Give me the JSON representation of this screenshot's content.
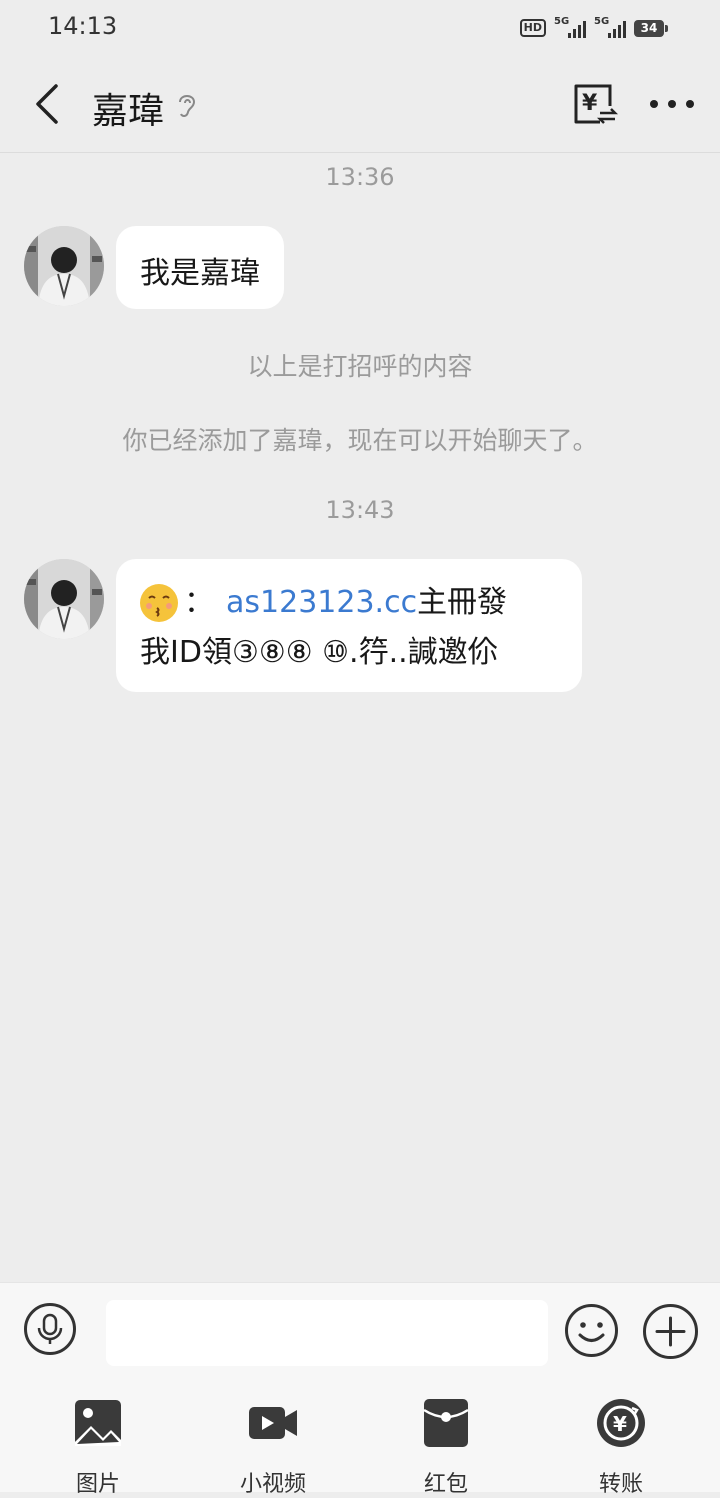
{
  "status_bar": {
    "time": "14:13",
    "hd_label": "HD",
    "network1": "5G",
    "network2": "5G",
    "battery": "34"
  },
  "header": {
    "title": "嘉瑋",
    "icons": [
      "back-arrow-icon",
      "ear-icon",
      "transfer-icon",
      "more-icon"
    ]
  },
  "chat": {
    "timestamp1": "13:36",
    "message1": "我是嘉瑋",
    "system1": "以上是打招呼的内容",
    "system2": "你已经添加了嘉瑋，现在可以开始聊天了。",
    "timestamp2": "13:43",
    "message2": {
      "prefix": "：",
      "link": "as123123.cc",
      "after_link": " 主冊發",
      "line2": "我ID領③⑧⑧ ⑩.筕..諴邀伱"
    }
  },
  "input_bar": {
    "placeholder": "",
    "icons": [
      "microphone-icon",
      "emoji-icon",
      "plus-icon"
    ]
  },
  "actions": [
    {
      "label": "图片",
      "icon": "image-icon"
    },
    {
      "label": "小视频",
      "icon": "video-icon"
    },
    {
      "label": "红包",
      "icon": "red-packet-icon"
    },
    {
      "label": "转账",
      "icon": "transfer-icon"
    }
  ],
  "colors": {
    "background": "#ededed",
    "bubble": "#ffffff",
    "link": "#3b7ad0",
    "muted_text": "#9b9b9b",
    "icon": "#333333"
  }
}
